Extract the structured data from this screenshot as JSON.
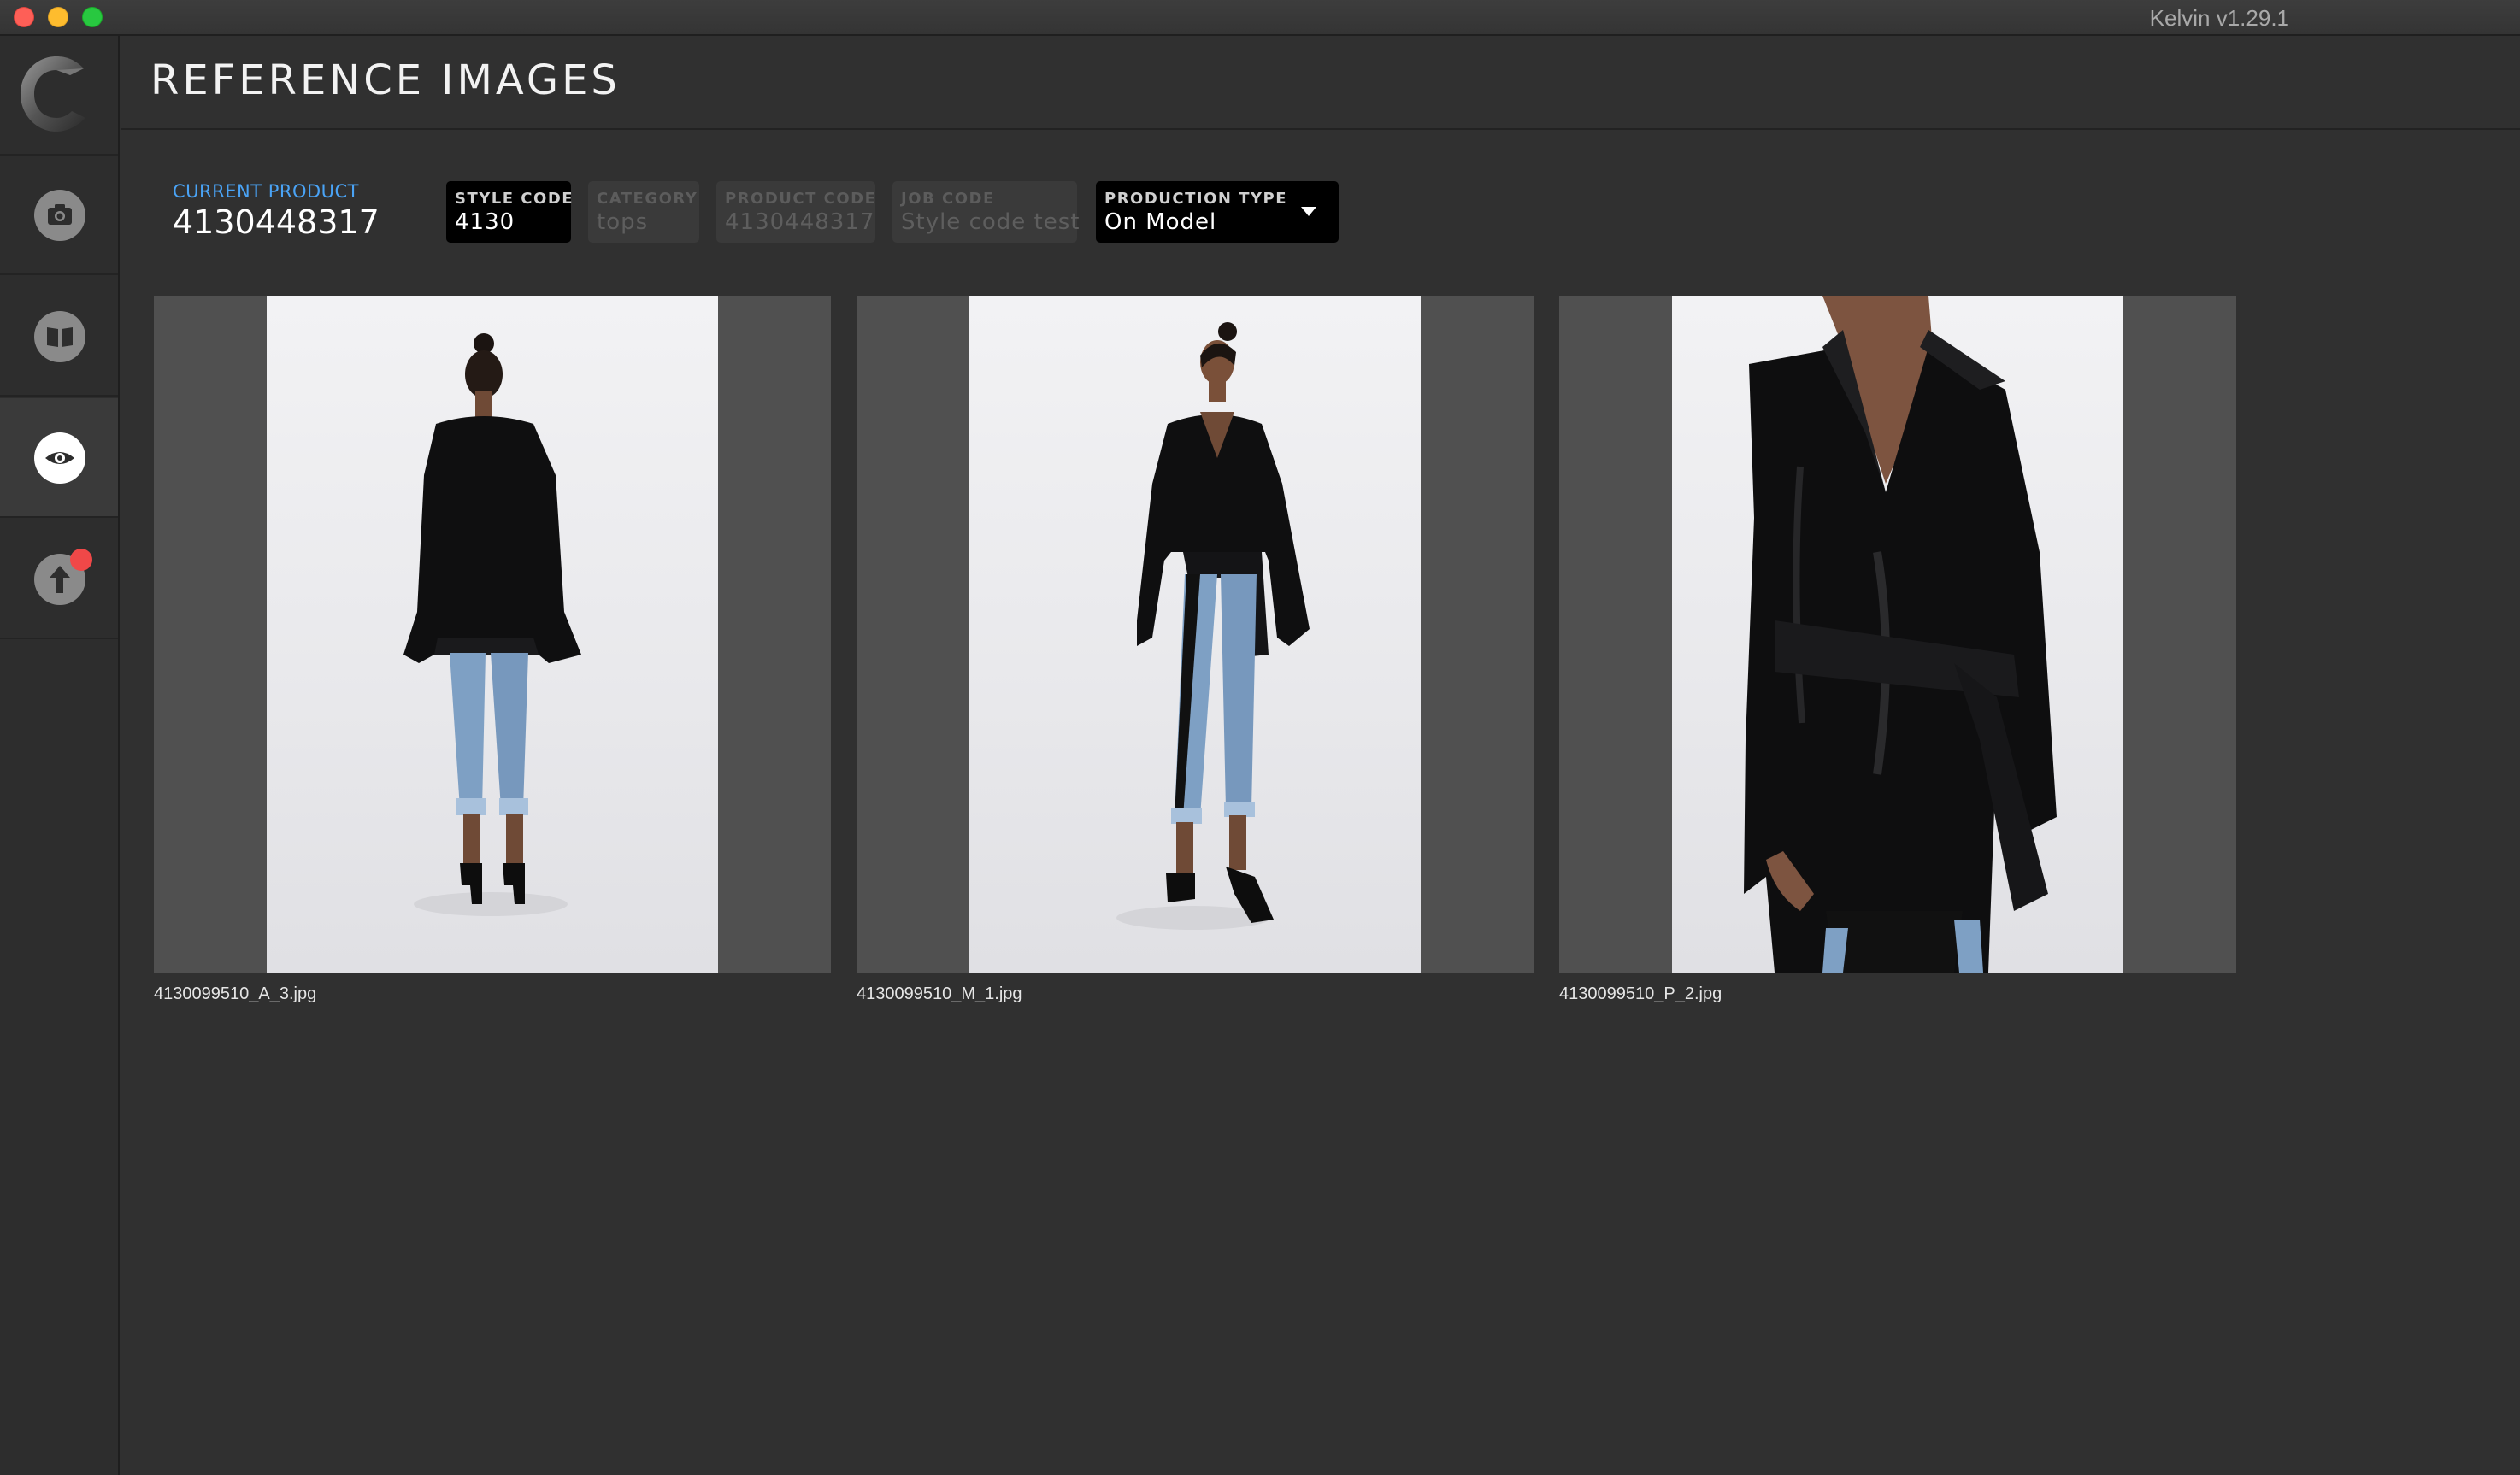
{
  "window": {
    "title": "Kelvin v1.29.1"
  },
  "sidebar": {
    "items": [
      {
        "name": "capture",
        "icon": "camera-icon",
        "active": false,
        "badge": false
      },
      {
        "name": "library",
        "icon": "book-icon",
        "active": false,
        "badge": false
      },
      {
        "name": "reference",
        "icon": "eye-icon",
        "active": true,
        "badge": false
      },
      {
        "name": "upload",
        "icon": "upload-arrow-icon",
        "active": false,
        "badge": true
      }
    ],
    "badge_color": "#f04848"
  },
  "header": {
    "title": "REFERENCE IMAGES"
  },
  "product": {
    "current_label": "CURRENT PRODUCT",
    "current_value": "4130448317",
    "fields": {
      "style_code": {
        "label": "STYLE CODE",
        "value": "4130",
        "state": "active"
      },
      "category": {
        "label": "CATEGORY",
        "value": "tops",
        "state": "disabled"
      },
      "product_code": {
        "label": "PRODUCT CODE",
        "value": "4130448317",
        "state": "disabled"
      },
      "job_code": {
        "label": "JOB CODE",
        "value": "Style code test",
        "state": "disabled"
      },
      "production_type": {
        "label": "PRODUCTION TYPE",
        "value": "On Model",
        "state": "active"
      }
    }
  },
  "images": [
    {
      "filename": "4130099510_A_3.jpg",
      "view": "back"
    },
    {
      "filename": "4130099510_M_1.jpg",
      "view": "front"
    },
    {
      "filename": "4130099510_P_2.jpg",
      "view": "detail"
    }
  ],
  "colors": {
    "accent": "#4aa3f5",
    "background": "#303030",
    "sidebar": "#2d2d2d"
  }
}
